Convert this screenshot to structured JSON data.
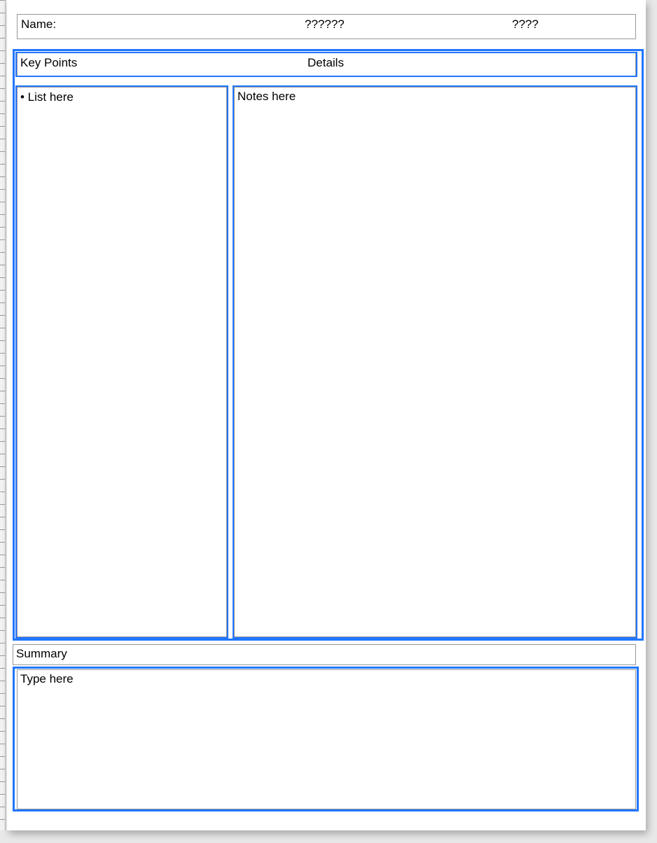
{
  "header": {
    "name_label": "Name:",
    "field2_text": "??????",
    "field3_text": "????"
  },
  "column_headers": {
    "left": "Key Points",
    "right": "Details"
  },
  "columns": {
    "left_bullet_text": "•  List here",
    "right_text": "Notes here"
  },
  "summary": {
    "label": "Summary",
    "placeholder": "Type here"
  },
  "selection": {
    "color": "#2176ff"
  }
}
